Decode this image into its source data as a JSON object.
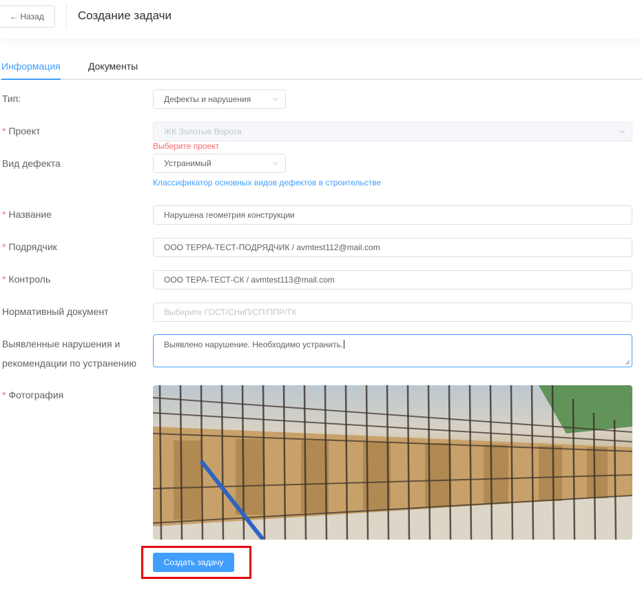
{
  "header": {
    "back_label": "← Назад",
    "title": "Создание задачи"
  },
  "tabs": [
    {
      "label": "Информация",
      "active": true
    },
    {
      "label": "Документы",
      "active": false
    }
  ],
  "form": {
    "type": {
      "label": "Тип:",
      "value": "Дефекты и нарушения"
    },
    "project": {
      "label": "Проект",
      "required": true,
      "value": "ЖК Золотые Ворота",
      "disabled": true,
      "error": "Выберите проект"
    },
    "defect_kind": {
      "label": "Вид дефекта",
      "value": "Устранимый",
      "link": "Классификатор основных видов дефектов в строительстве"
    },
    "name": {
      "label": "Название",
      "required": true,
      "value": "Нарушена геометрия конструкции"
    },
    "contractor": {
      "label": "Подрядчик",
      "required": true,
      "value": "ООО ТЕРРА-ТЕСТ-ПОДРЯДЧИК / avmtest112@mail.com"
    },
    "control": {
      "label": "Контроль",
      "required": true,
      "value": "ООО ТЕРА-ТЕСТ-СК / avmtest113@mail.com"
    },
    "norm_doc": {
      "label": "Нормативный документ",
      "placeholder": "Выберите ГОСТ/СНиП/СП/ППР/ТК"
    },
    "violations": {
      "label_line1": "Выявленные нарушения и",
      "label_line2": "рекомендации по устранению",
      "value": "Выявлено нарушение. Необходимо устранить."
    },
    "photo": {
      "label": "Фотография",
      "required": true
    }
  },
  "actions": {
    "submit_label": "Создать задачу"
  },
  "colors": {
    "primary": "#409eff",
    "error": "#f56c6c",
    "highlight": "#e60012"
  }
}
